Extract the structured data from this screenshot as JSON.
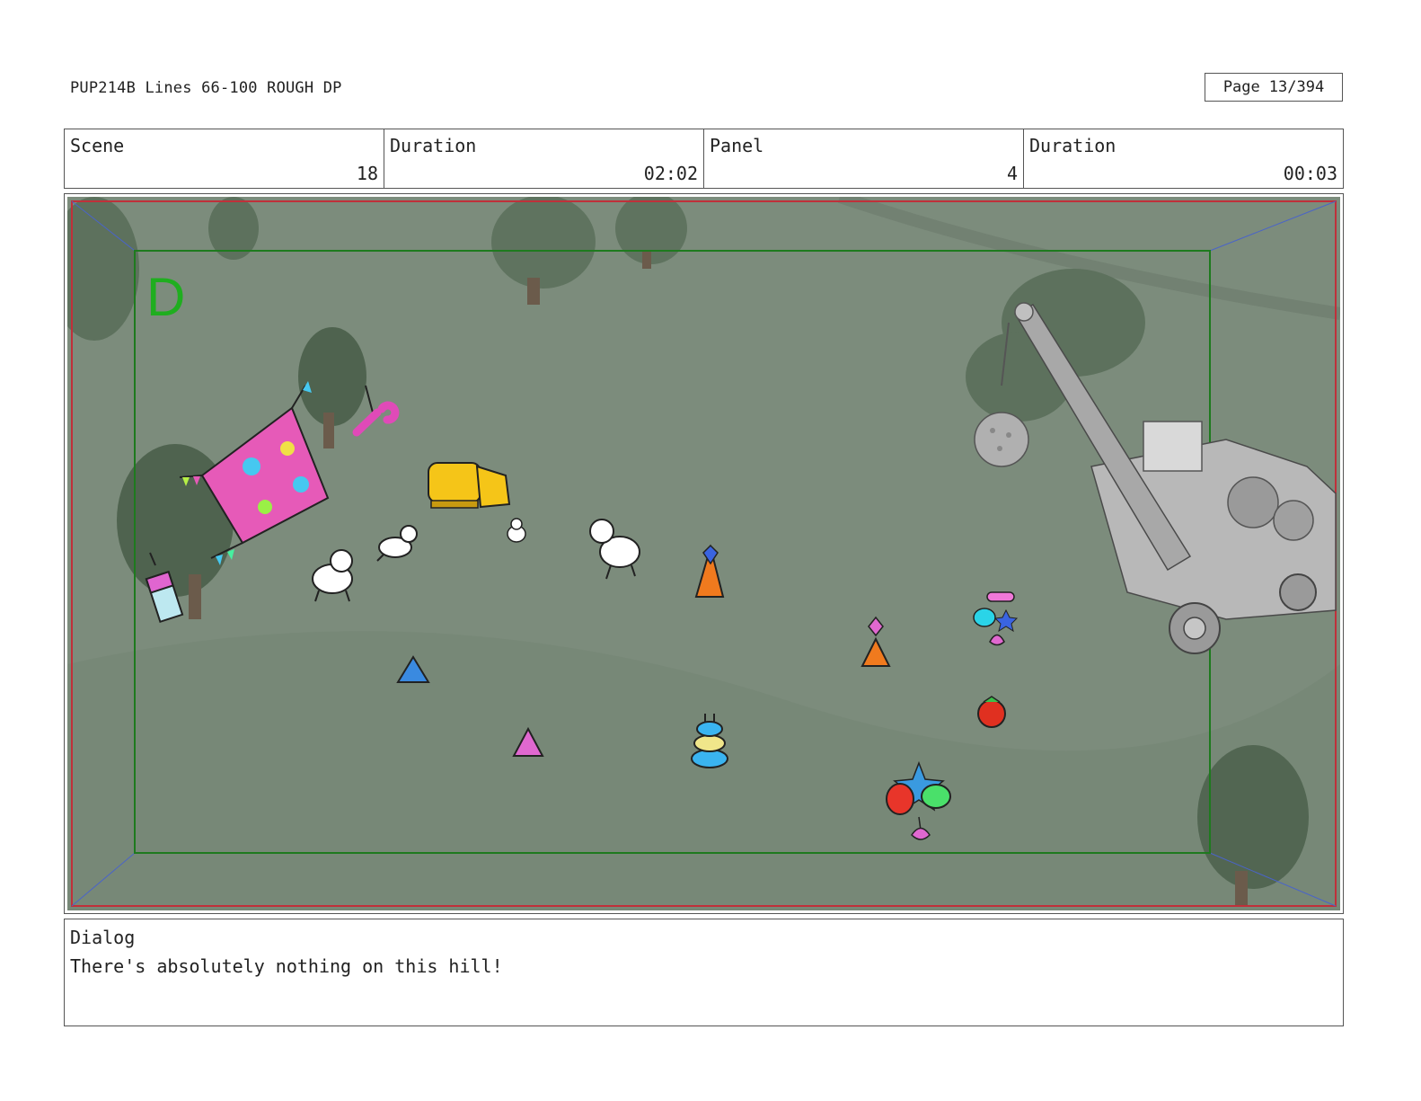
{
  "header": {
    "title": "PUP214B Lines 66-100 ROUGH DP",
    "page_label": "Page",
    "page_value": "13/394"
  },
  "info": {
    "scene_label": "Scene",
    "scene_value": "18",
    "scene_duration_label": "Duration",
    "scene_duration_value": "02:02",
    "panel_label": "Panel",
    "panel_value": "4",
    "panel_duration_label": "Duration",
    "panel_duration_value": "00:03"
  },
  "panel": {
    "marker_letter": "D",
    "colors": {
      "ground": "#7c8c7c",
      "safe_frame": "#1e7a1e",
      "outer_frame": "#c0303a",
      "marker": "#1fae1f"
    }
  },
  "dialog": {
    "label": "Dialog",
    "text": "There's absolutely nothing on this hill!"
  }
}
